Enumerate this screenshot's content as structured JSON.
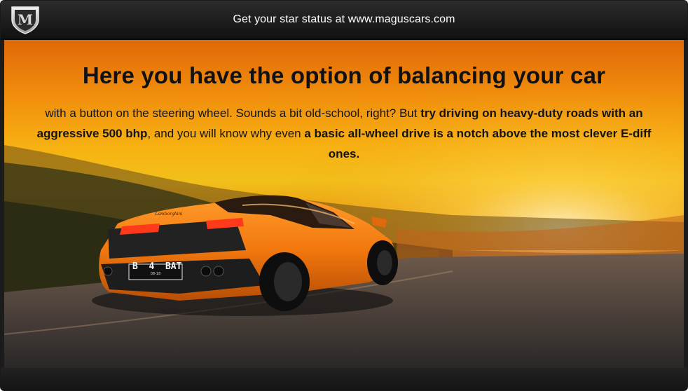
{
  "header": {
    "text": "Get your star status at www.maguscars.com",
    "logo_letter": "M"
  },
  "headline": "Here you have the option of balancing your car",
  "body": {
    "part1": "with a button on the steering wheel. Sounds a bit old-school, right? But ",
    "bold1": "try driving on heavy-duty roads with an aggressive 500 bhp",
    "part2": ", and you will know why even ",
    "bold2": "a basic all-wheel drive is a notch above the most clever E-diff ones."
  },
  "car": {
    "plate": "B  4  BAT",
    "plate_small": "08-18",
    "badge": "Lamborghini",
    "color": "#f2780e"
  },
  "colors": {
    "header_bg": "#1c1c1c",
    "sky_top": "#e06808",
    "sky_glow": "#f7b212"
  }
}
